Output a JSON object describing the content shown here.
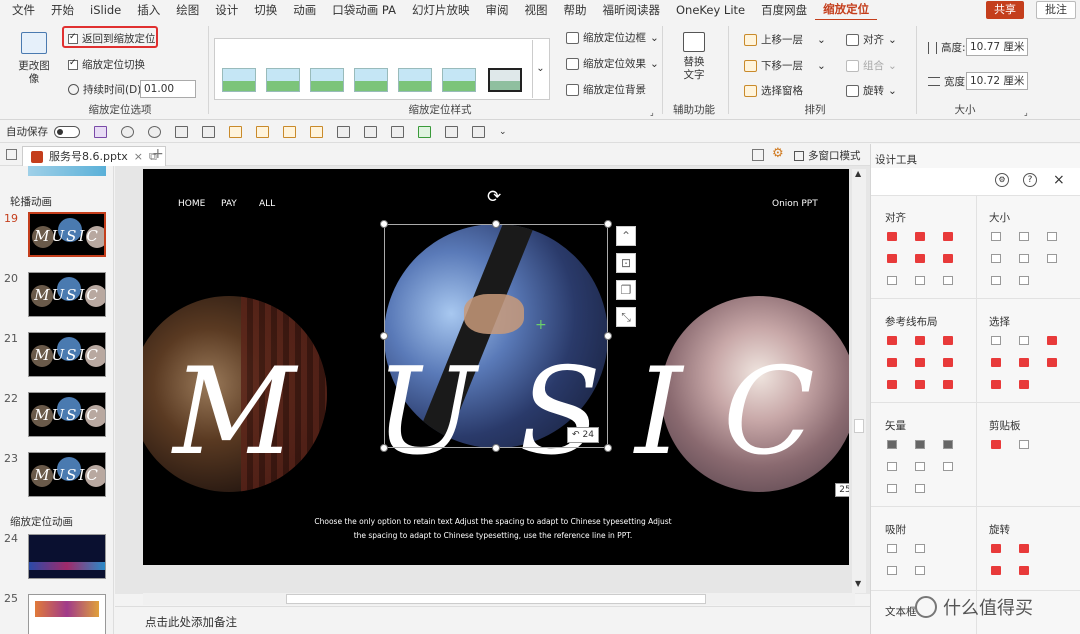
{
  "menu": {
    "items": [
      "文件",
      "开始",
      "iSlide",
      "插入",
      "绘图",
      "设计",
      "切换",
      "动画",
      "口袋动画 PA",
      "幻灯片放映",
      "审阅",
      "视图",
      "帮助",
      "福昕阅读器",
      "OneKey Lite",
      "百度网盘",
      "缩放定位"
    ],
    "active": "缩放定位",
    "share": "共享",
    "comment": "批注"
  },
  "ribbon": {
    "change_image": "更改图像",
    "return_to_zoom": "返回到缩放定位",
    "zoom_switch": "缩放定位切换",
    "duration_label": "持续时间(D):",
    "duration_value": "01.00",
    "options_group": "缩放定位选项",
    "border": "缩放定位边框",
    "effect": "缩放定位效果",
    "background": "缩放定位背景",
    "style_group": "缩放定位样式",
    "alt_text": "替换文字",
    "aux_group": "辅助功能",
    "bring_forward": "上移一层",
    "send_backward": "下移一层",
    "selection_pane": "选择窗格",
    "align": "对齐",
    "group": "组合",
    "rotate": "旋转",
    "arrange_group": "排列",
    "height_label": "高度:",
    "height_value": "10.77 厘米",
    "width_label": "宽度:",
    "width_value": "10.72 厘米",
    "size_group": "大小"
  },
  "qat": {
    "autosave_label": "自动保存"
  },
  "tabs": {
    "file_name": "服务号8.6.pptx",
    "multi_window": "多窗口模式"
  },
  "slides": {
    "section1": "轮播动画",
    "section2": "缩放定位动画",
    "numbers": [
      "19",
      "20",
      "21",
      "22",
      "23",
      "24",
      "25"
    ],
    "current": "19"
  },
  "slide": {
    "nav_home": "HOME",
    "nav_pay": "PAY",
    "nav_all": "ALL",
    "brand": "Onion PPT",
    "letters": [
      "M",
      "U",
      "S",
      "I",
      "C"
    ],
    "caption_line1": "Choose the only option to retain text Adjust the spacing to adapt to Chinese typesetting Adjust",
    "caption_line2": "the spacing to adapt to Chinese typesetting, use the reference line in PPT.",
    "zoom_badge": "24",
    "side_badge": "25"
  },
  "notes": {
    "placeholder": "点击此处添加备注"
  },
  "panel": {
    "title": "设计工具",
    "align": "对齐",
    "size": "大小",
    "guides": "参考线布局",
    "select": "选择",
    "vector": "矢量",
    "clipboard": "剪贴板",
    "snap": "吸附",
    "rotate": "旋转",
    "textbox": "文本框",
    "watermark": "什么值得买"
  },
  "colors": {
    "accent": "#c43e1c",
    "icon_red": "#e83a3a"
  }
}
